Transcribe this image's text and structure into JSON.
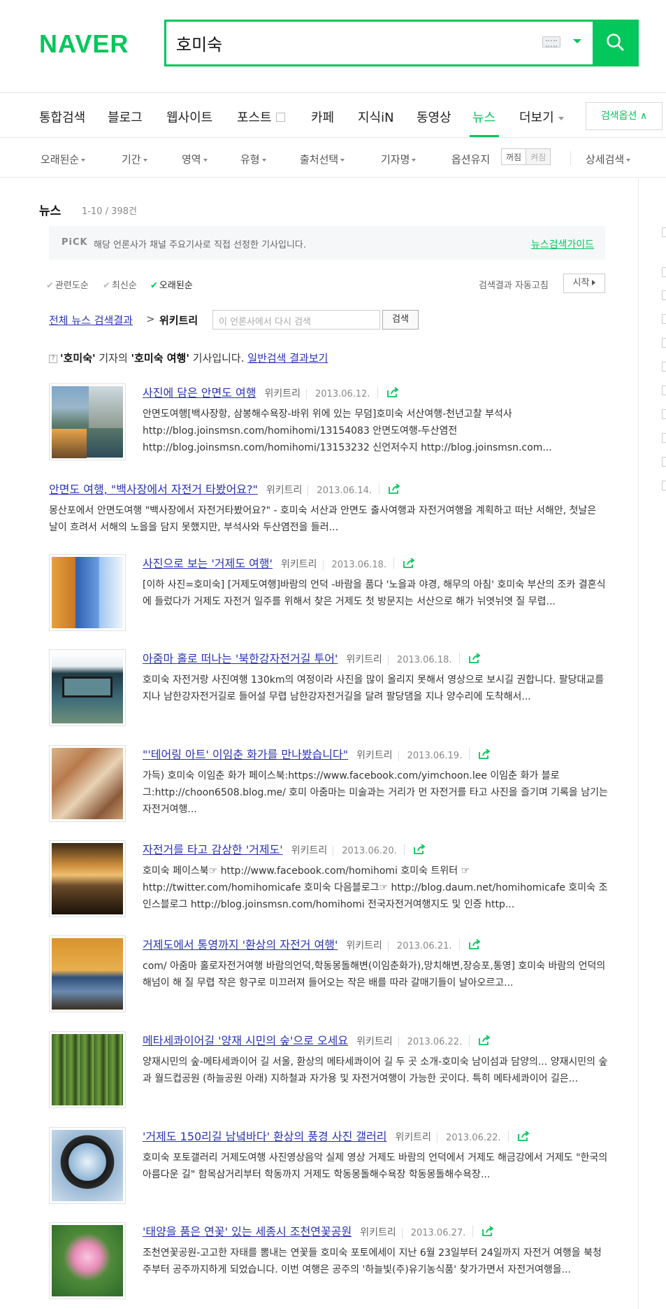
{
  "search": {
    "logo": "NAVER",
    "query": "호미숙"
  },
  "tabs": {
    "items": [
      "통합검색",
      "블로그",
      "웹사이트",
      "포스트",
      "카페",
      "지식iN",
      "동영상",
      "뉴스",
      "더보기"
    ],
    "active": "뉴스",
    "option_button": "검색옵션 ∧"
  },
  "filters": {
    "items": [
      "오래된순",
      "기간",
      "영역",
      "유형",
      "출처선택",
      "기자명"
    ],
    "keep_label": "옵션유지",
    "keep_on": "꺼짐",
    "keep_off": "켜짐",
    "detail": "상세검색"
  },
  "section": {
    "title": "뉴스",
    "count": "1-10 / 398건",
    "pick_label": "PiCK",
    "pick_text": "해당 언론사가 채널 주요기사로 직접 선정한 기사입니다.",
    "pick_link": "뉴스검색가이드"
  },
  "sort": {
    "items": [
      "관련도순",
      "최신순",
      "오래된순"
    ],
    "active": "오래된순",
    "autorefresh": "검색결과 자동고침",
    "start": "시작"
  },
  "crumb": {
    "all_link": "전체 뉴스 검색결과",
    "sep": ">",
    "current": "위키트리",
    "input_placeholder": "이 언론사에서 다시 검색",
    "button": "검색"
  },
  "notice": {
    "q": "?",
    "reporter": "'호미숙'",
    "mid": " 기자의 ",
    "keyword": "'호미숙 여행'",
    "tail": " 기사입니다. ",
    "link": "일반검색 결과보기"
  },
  "articles": [
    {
      "title": "사진에 담은 안면도 여행",
      "source": "위키트리",
      "date": "2013.06.12.",
      "body": "안면도여행[백사장항, 삼봉해수욕장-바위 위에 있는 무덤]호미숙 서산여행-천년고찰 부석사 http://blog.joinsmsn.com/homihomi/13154083 안면도여행-두산염전 http://blog.joinsmsn.com/homihomi/13153232 신언저수지 http://blog.joinsmsn.com..."
    },
    {
      "title": "안면도 여행, \"백사장에서 자전거 타봤어요?\"",
      "source": "위키트리",
      "date": "2013.06.14.",
      "body": "몽산포에서 안면도여행 \"백사장에서 자전거타봤어요?\" - 호미숙 서산과 안면도 출사여행과 자전거여행을 계획하고 떠난 서해안, 첫날은 날이 흐려서 서해의 노을을 담지 못했지만, 부석사와 두산염전을 들러..."
    },
    {
      "title": "사진으로 보는 '거제도 여행'",
      "source": "위키트리",
      "date": "2013.06.18.",
      "body": "[이하 사진=호미숙] [거제도여행]바람의 언덕 -바람을 품다 '노을과 야경, 해무의 아침' 호미숙 부산의 조카 결혼식에 들렀다가 거제도 자전거 일주를 위해서 찾은 거제도 첫 방문지는 서산으로 해가 뉘엿뉘엿 질 무렵..."
    },
    {
      "title": "아줌마 홀로 떠나는 '북한강자전거길 투어'",
      "source": "위키트리",
      "date": "2013.06.18.",
      "body": "호미숙 자전거랑 사진여행 130km의 여정이라 사진을 많이 올리지 못해서 영상으로 보시길 권합니다. 팔당대교를 지나 남한강자전거길로 들어설 무렵 남한강자전거길을 달려 팔당댐을 지나 양수리에 도착해서..."
    },
    {
      "title": "\"'테어링 아트' 이임춘 화가를 만나봤습니다\"",
      "source": "위키트리",
      "date": "2013.06.19.",
      "body": "가득) 호미숙 이임춘 화가 페이스북:https://www.facebook.com/yimchoon.lee 이임춘 화가 블로그:http://choon6508.blog.me/ 호미 아줌마는 미술과는 거리가 먼 자전거를 타고 사진을 즐기며 기록을 남기는 자전거여행..."
    },
    {
      "title": "자전거를 타고 감상한 '거제도'",
      "source": "위키트리",
      "date": "2013.06.20.",
      "body": "호미숙 페이스북☞ http://www.facebook.com/homihomi 호미숙 트위터 ☞ http://twitter.com/homihomicafe 호미숙 다음블로그☞ http://blog.daum.net/homihomicafe 호미숙 조인스블로그 http://blog.joinsmsn.com/homihomi 전국자전거여행지도 및 인증 http..."
    },
    {
      "title": "거제도에서 통영까지 '환상의 자전거 여행'",
      "source": "위키트리",
      "date": "2013.06.21.",
      "body": "com/ 아줌마 홀로자전거여행 바람의언덕,학동몽돌해변(이임춘화가),망치해변,장승포,통영] 호미숙 바람의 언덕의 해넘이 해 질 무렵 작은 항구로 미끄러져 들어오는 작은 배를 따라 갈매기들이 날아오르고..."
    },
    {
      "title": "메타세콰이어길 '양재 시민의 숲'으로 오세요",
      "source": "위키트리",
      "date": "2013.06.22.",
      "body": "양재시민의 숲-메타세콰이어 길 서울, 환상의 메타세콰이어 길 두 곳 소개-호미숙 남이섬과 담양의... 양재시민의 숲과 월드컵공원 (하늘공원 아래) 지하철과 자가용 및 자전거여행이 가능한 곳이다. 특히 메타세콰이어 길은..."
    },
    {
      "title": "'거제도 150리길 남녘바다' 환상의 풍경 사진 갤러리",
      "source": "위키트리",
      "date": "2013.06.22.",
      "body": "호미숙 포토갤러리 거제도여행 사진영상음악 실제 영상 거제도 바람의 언덕에서 거제도 해금강에서 거제도 \"한국의 아름다운 길\" 함목삼거리부터 학동까지 거제도 학동몽돌해수욕장 학동몽돌해수욕장..."
    },
    {
      "title": "'태양을 품은 연꽃' 있는 세종시 조천연꽃공원",
      "source": "위키트리",
      "date": "2013.06.27.",
      "body": "조천연꽃공원-고고한 자태를 뽐내는 연꽃들 호미숙 포토에세이 지난 6월 23일부터 24일까지 자전거 여행을 북청주부터 공주까지하게 되었습니다. 이번 여행은 공주의 '하늘빛(주)유기농식품' 찾가가면서 자전거여행을..."
    }
  ],
  "colors": {
    "brand": "#03c75a",
    "link": "#2a33b4"
  }
}
